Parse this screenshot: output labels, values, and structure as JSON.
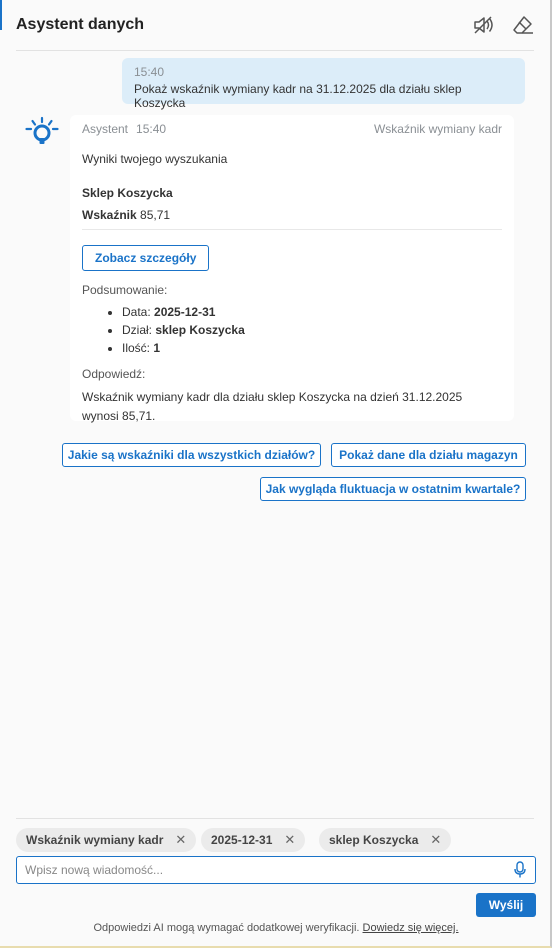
{
  "header": {
    "title": "Asystent danych",
    "mute_icon": "speaker-muted-icon",
    "clear_icon": "eraser-icon"
  },
  "user_message": {
    "time": "15:40",
    "text": "Pokaż wskaźnik wymiany kadr na 31.12.2025 dla działu sklep Koszycka"
  },
  "bot_message": {
    "sender": "Asystent",
    "time": "15:40",
    "topic": "Wskaźnik wymiany kadr",
    "intro": "Wyniki twojego wyszukania",
    "result_title": "Sklep Koszycka",
    "result_metric_label": "Wskaźnik",
    "result_metric_value": "85,71",
    "details_button": "Zobacz szczegóły",
    "summary_label": "Podsumowanie:",
    "summary": [
      {
        "key": "Data:",
        "value": "2025-12-31"
      },
      {
        "key": "Dział:",
        "value": "sklep Koszycka"
      },
      {
        "key": "Ilość:",
        "value": "1"
      }
    ],
    "answer_label": "Odpowiedź:",
    "answer_text": "Wskaźnik wymiany kadr dla działu sklep Koszycka na dzień 31.12.2025 wynosi 85,71."
  },
  "suggestions": [
    "Jakie są wskaźniki dla wszystkich działów?",
    "Pokaż dane dla działu magazyn",
    "Jak wygląda fluktuacja w ostatnim kwartale?"
  ],
  "filters": [
    {
      "label": "Wskaźnik wymiany kadr"
    },
    {
      "label": "2025-12-31"
    },
    {
      "label": "sklep Koszycka"
    }
  ],
  "composer": {
    "placeholder": "Wpisz nową wiadomość...",
    "mic_icon": "microphone-icon",
    "send_label": "Wyślij"
  },
  "disclaimer": {
    "text": "Odpowiedzi AI mogą wymagać dodatkowej weryfikacji.",
    "link": "Dowiedz się więcej."
  },
  "colors": {
    "accent": "#1a73c8",
    "user_bubble": "#dcedf9",
    "background": "#fafafa"
  }
}
